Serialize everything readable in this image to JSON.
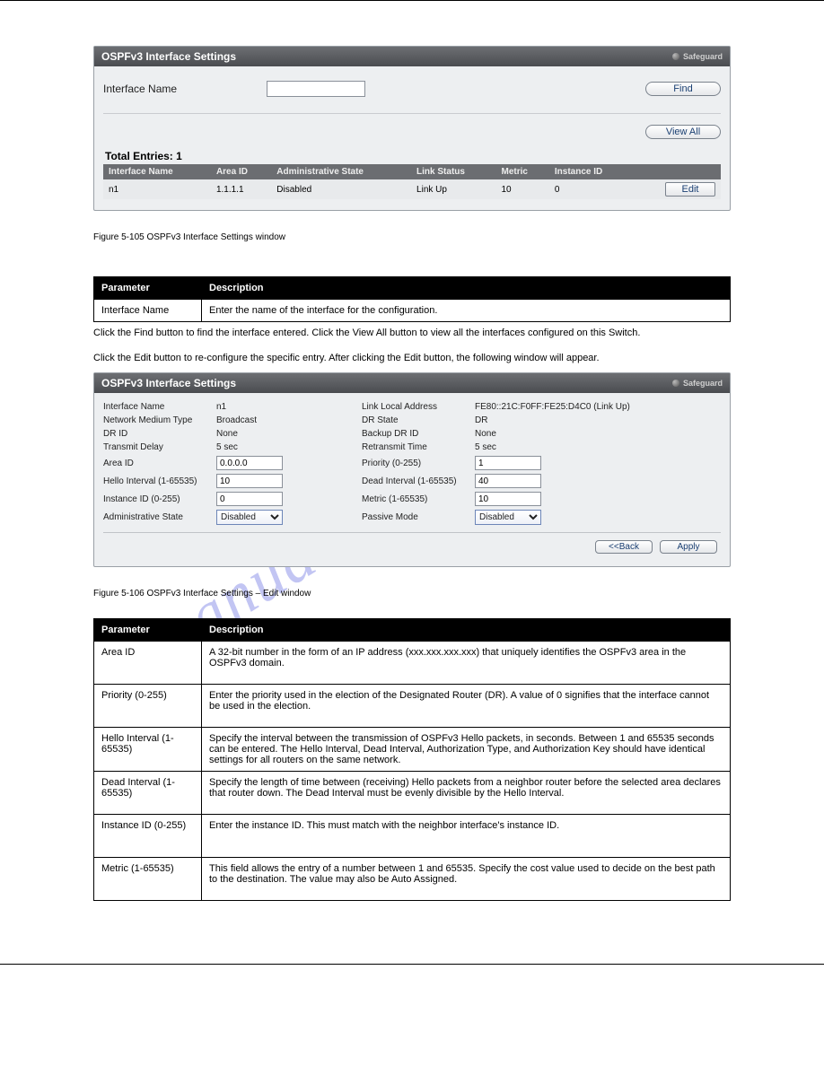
{
  "watermark": "manualshive.com",
  "screenshot1": {
    "title": "OSPFv3 Interface Settings",
    "safeguard": "Safeguard",
    "search_label": "Interface Name",
    "find_btn": "Find",
    "viewall_btn": "View All",
    "total_label": "Total Entries: 1",
    "headers": {
      "iface": "Interface Name",
      "area": "Area ID",
      "admin": "Administrative State",
      "link": "Link Status",
      "metric": "Metric",
      "instance": "Instance ID"
    },
    "row": {
      "iface": "n1",
      "area": "1.1.1.1",
      "admin": "Disabled",
      "link": "Link Up",
      "metric": "10",
      "instance": "0",
      "edit": "Edit"
    }
  },
  "params1": {
    "hparam": "Parameter",
    "hdesc": "Description",
    "rows": [
      {
        "name": "Interface Name",
        "desc": "Enter the name of the interface for the configuration."
      }
    ]
  },
  "inter1": "Click the Find button to find the interface entered. Click the View All button to view all the interfaces configured on this Switch.",
  "inter2": "Click the Edit button to re-configure the specific entry. After clicking the Edit button, the following window will appear.",
  "caption1": "Figure 5-105 OSPFv3 Interface Settings window",
  "caption2": "Figure 5-106 OSPFv3 Interface Settings – Edit window",
  "screenshot2": {
    "title": "OSPFv3 Interface Settings",
    "safeguard": "Safeguard",
    "labels": {
      "iface": "Interface Name",
      "netmed": "Network Medium Type",
      "drid": "DR ID",
      "tdelay": "Transmit Delay",
      "areaid": "Area ID",
      "hello": "Hello Interval (1-65535)",
      "instance": "Instance ID (0-255)",
      "admin": "Administrative State",
      "lla": "Link Local Address",
      "drstate": "DR State",
      "backup": "Backup DR ID",
      "retrans": "Retransmit Time",
      "priority": "Priority (0-255)",
      "dead": "Dead Interval (1-65535)",
      "metric": "Metric (1-65535)",
      "passive": "Passive Mode"
    },
    "values": {
      "iface": "n1",
      "netmed": "Broadcast",
      "drid": "None",
      "tdelay": "5 sec",
      "areaid": "0.0.0.0",
      "hello": "10",
      "instance": "0",
      "admin": "Disabled",
      "lla": "FE80::21C:F0FF:FE25:D4C0 (Link Up)",
      "drstate": "DR",
      "backup": "None",
      "retrans": "5 sec",
      "priority": "1",
      "dead": "40",
      "metric": "10",
      "passive": "Disabled"
    },
    "back_btn": "<<Back",
    "apply_btn": "Apply"
  },
  "params2": {
    "hparam": "Parameter",
    "hdesc": "Description",
    "rows": [
      {
        "name": "Area ID",
        "desc": "A 32-bit number in the form of an IP address (xxx.xxx.xxx.xxx) that uniquely identifies the OSPFv3 area in the OSPFv3 domain."
      },
      {
        "name": "Priority (0-255)",
        "desc": "Enter the priority used in the election of the Designated Router (DR). A value of 0 signifies that the interface cannot be used in the election."
      },
      {
        "name": "Hello Interval (1-65535)",
        "desc": "Specify the interval between the transmission of OSPFv3 Hello packets, in seconds. Between 1 and 65535 seconds can be entered. The Hello Interval, Dead Interval, Authorization Type, and Authorization Key should have identical settings for all routers on the same network."
      },
      {
        "name": "Dead Interval (1-65535)",
        "desc": "Specify the length of time between (receiving) Hello packets from a neighbor router before the selected area declares that router down. The Dead Interval must be evenly divisible by the Hello Interval."
      },
      {
        "name": "Instance ID (0-255)",
        "desc": "Enter the instance ID. This must match with the neighbor interface's instance ID."
      },
      {
        "name": "Metric (1-65535)",
        "desc": "This field allows the entry of a number between 1 and 65535. Specify the cost value used to decide on the best path to the destination. The value may also be Auto Assigned."
      }
    ]
  }
}
